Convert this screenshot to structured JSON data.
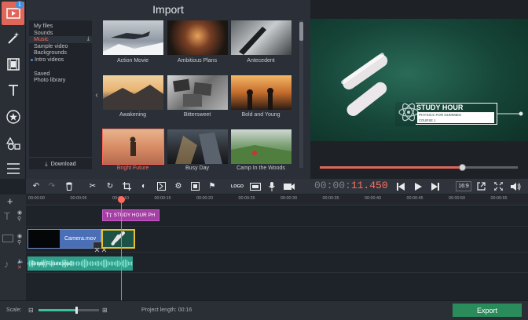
{
  "import": {
    "title": "Import",
    "categories": [
      "My files",
      "Sounds",
      "Music",
      "Sample video",
      "Backgrounds",
      "Intro videos"
    ],
    "categories2": [
      "Saved",
      "Photo library"
    ],
    "download_label": "Download",
    "thumbnails": [
      {
        "label": "Action Movie",
        "highlight": false
      },
      {
        "label": "Ambitious Plans",
        "highlight": false
      },
      {
        "label": "Antecedent",
        "highlight": false
      },
      {
        "label": "Awakening",
        "highlight": false
      },
      {
        "label": "Bittersweet",
        "highlight": false
      },
      {
        "label": "Bold and Young",
        "highlight": false
      },
      {
        "label": "Bright Future",
        "highlight": true
      },
      {
        "label": "Busy Day",
        "highlight": false
      },
      {
        "label": "Camp In the Woods",
        "highlight": false
      }
    ]
  },
  "preview": {
    "title_main": "STUDY HOUR",
    "title_sub": "PHYSICS FOR DUMMIES",
    "title_sub2": "COURSE 1",
    "seek_progress": 0.72
  },
  "toolbar": {
    "timecode_dim": "00:00:",
    "timecode_lit": "11.450",
    "aspect": "16:9",
    "logo_label": "LOGO"
  },
  "ruler": {
    "ticks": [
      "00:00:00",
      "00:00:05",
      "00:00:10",
      "00:00:15",
      "00:00:20",
      "00:00:25",
      "00:00:30",
      "00:00:35",
      "00:00:40",
      "00:00:45",
      "00:00:50",
      "00:00:55"
    ]
  },
  "timeline": {
    "title_clip": "STUDY HOUR PH",
    "video_clip": "Camera.mov",
    "audio_clip": "Bright Future.mp3"
  },
  "bottom": {
    "scale_label": "Scale:",
    "project_length_label": "Project length:",
    "project_length_value": "00:16",
    "scale_level": 0.62,
    "export_label": "Export"
  },
  "colors": {
    "accent": "#ff6a5b",
    "export": "#2a8c5a",
    "title_clip": "#a53fa6",
    "video_clip": "#4a6fb6",
    "audio_clip": "#2f9e8a"
  },
  "icons": {
    "sidebar": [
      "import-icon",
      "magic-wand-icon",
      "film-icon",
      "text-icon",
      "star-icon",
      "shapes-icon",
      "menu-icon"
    ],
    "badge": "1"
  }
}
